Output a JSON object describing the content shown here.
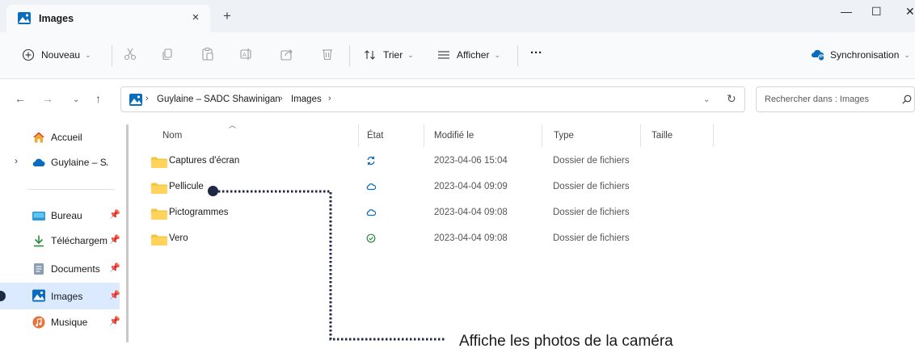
{
  "window": {
    "tab_title": "Images",
    "tab_close": "×",
    "new_tab": "+",
    "minimize": "—",
    "maximize": "☐",
    "close": "✕"
  },
  "commandbar": {
    "new_label": "Nouveau",
    "sort_label": "Trier",
    "view_label": "Afficher",
    "more_label": "···",
    "sync_label": "Synchronisation"
  },
  "address": {
    "crumbs": [
      "Guylaine – SADC Shawinigan",
      "Images"
    ],
    "separator": "›"
  },
  "search": {
    "placeholder": "Rechercher dans : Images"
  },
  "sidebar": {
    "items": [
      {
        "label": "Accueil",
        "icon": "home-icon"
      },
      {
        "label": "Guylaine – SADC Shawinigan",
        "icon": "onedrive-cloud-icon"
      },
      {
        "label": "Bureau",
        "icon": "desktop-icon"
      },
      {
        "label": "Téléchargements",
        "icon": "download-icon"
      },
      {
        "label": "Documents",
        "icon": "documents-icon"
      },
      {
        "label": "Images",
        "icon": "pictures-icon",
        "selected": true
      },
      {
        "label": "Musique",
        "icon": "music-icon"
      }
    ]
  },
  "list": {
    "columns": [
      "Nom",
      "État",
      "Modifié le",
      "Type",
      "Taille"
    ],
    "rows": [
      {
        "name": "Captures d'écran",
        "state": "syncing",
        "modified": "2023-04-06 15:04",
        "type": "Dossier de fichiers"
      },
      {
        "name": "Pellicule",
        "state": "cloud",
        "modified": "2023-04-04 09:09",
        "type": "Dossier de fichiers"
      },
      {
        "name": "Pictogrammes",
        "state": "cloud",
        "modified": "2023-04-04 09:08",
        "type": "Dossier de fichiers"
      },
      {
        "name": "Vero",
        "state": "available",
        "modified": "2023-04-04 09:08",
        "type": "Dossier de fichiers"
      }
    ]
  },
  "colors": {
    "accent_blue": "#0a6cbd",
    "folder_yellow": "#f6c443",
    "selected_bg": "#dbeafe",
    "state_green": "#2c8a3c",
    "callout_navy": "#1e2a44"
  },
  "callout": {
    "text": "Affiche les photos de la caméra"
  }
}
